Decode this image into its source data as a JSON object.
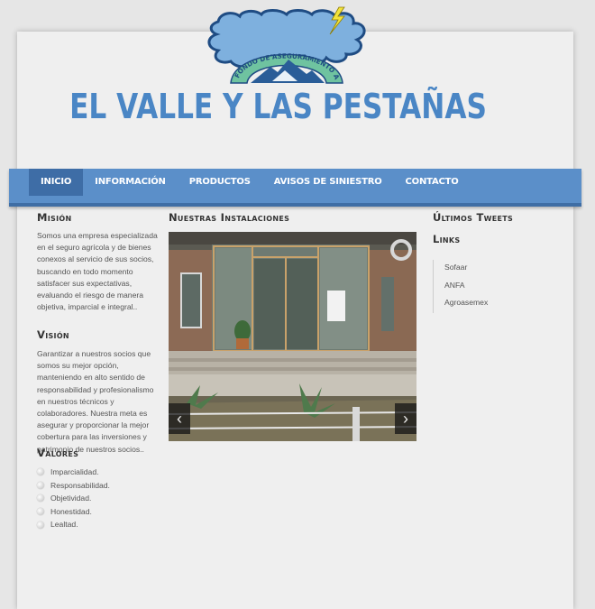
{
  "logo": {
    "arc_text": "FONDO DE ASEGURAMIENTO AGRÍCOLA",
    "colors": {
      "cloud": "#7eb0de",
      "cloud_dark": "#1f4c83",
      "arc": "#6fc3a0",
      "lightning": "#f3e33b"
    }
  },
  "site_title": "EL VALLE Y LAS PESTAÑAS",
  "nav": {
    "items": [
      {
        "label": "Inicio"
      },
      {
        "label": "Información"
      },
      {
        "label": "Productos"
      },
      {
        "label": "Avisos de Siniestro"
      },
      {
        "label": "Contacto"
      }
    ],
    "active_index": 0
  },
  "mision": {
    "title": "Misión",
    "text": "Somos una empresa especializada en el seguro agrícola y de bienes conexos al servicio de sus socios, buscando en todo momento satisfacer sus expectativas, evaluando el riesgo de manera objetiva, imparcial e integral.."
  },
  "vision": {
    "title": "Visión",
    "text": "Garantizar a nuestros socios que somos su mejor opción, manteniendo en alto sentido de responsabilidad y profesionalismo en nuestros técnicos y colaboradores. Nuestra meta es asegurar y proporcionar la mejor cobertura para las inversiones y patrimonio de nuestros socios.."
  },
  "valores": {
    "title": "Valores",
    "items": [
      "Imparcialidad.",
      "Responsabilidad.",
      "Objetividad.",
      "Honestidad.",
      "Lealtad."
    ]
  },
  "instalaciones": {
    "title": "Nuestras Instalaciones",
    "prev_icon": "chevron-left-icon",
    "next_icon": "chevron-right-icon"
  },
  "tweets": {
    "title": "Últimos Tweets"
  },
  "links": {
    "title": "Links",
    "items": [
      "Sofaar",
      "ANFA",
      "Agroasemex"
    ]
  },
  "colors": {
    "accent": "#5b8fc9",
    "accent_dark": "#3e6da6",
    "title": "#4a86c5"
  }
}
